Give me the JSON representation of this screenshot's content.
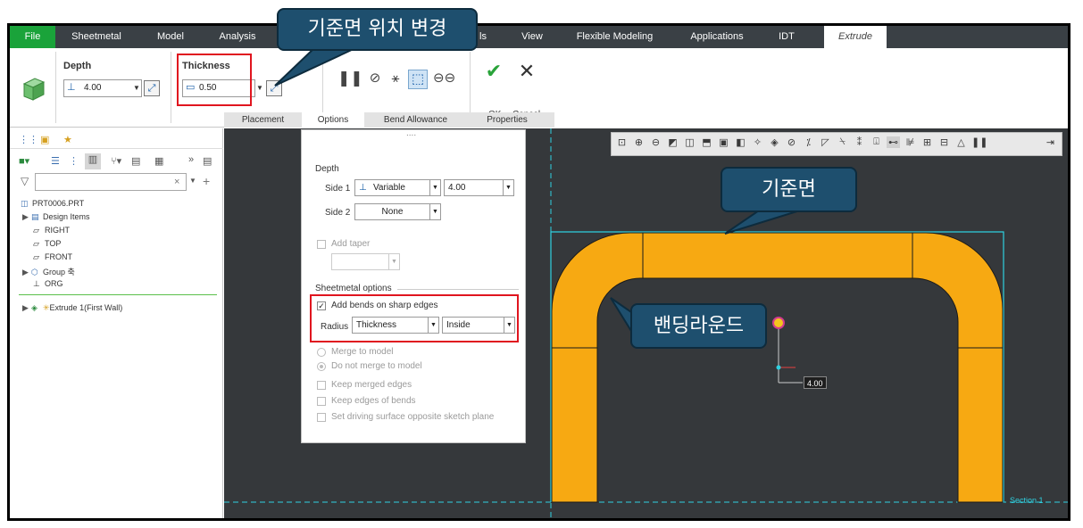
{
  "menu": {
    "file": "File",
    "tabs": [
      "Sheetmetal",
      "Model",
      "Analysis",
      "ls",
      "View",
      "Flexible Modeling",
      "Applications",
      "IDT",
      "Extrude"
    ]
  },
  "ribbon": {
    "depth_label": "Depth",
    "depth_value": "4.00",
    "thickness_label": "Thickness",
    "thickness_value": "0.50",
    "ok": "OK",
    "cancel": "Cancel",
    "subtabs": [
      "Placement",
      "Options",
      "Bend Allowance",
      "Properties"
    ]
  },
  "tree": {
    "root": "PRT0006.PRT",
    "items": [
      "Design Items",
      "RIGHT",
      "TOP",
      "FRONT",
      "Group 축",
      "ORG",
      "Extrude 1(First Wall)"
    ]
  },
  "options": {
    "dots": "....",
    "depth_header": "Depth",
    "side1_label": "Side 1",
    "side1_type": "Variable",
    "side1_value": "4.00",
    "side2_label": "Side 2",
    "side2_type": "None",
    "add_taper": "Add taper",
    "sheetmetal_header": "Sheetmetal options",
    "add_bends": "Add bends on sharp edges",
    "radius_label": "Radius",
    "radius_type": "Thickness",
    "radius_side": "Inside",
    "merge_to_model": "Merge to model",
    "do_not_merge": "Do not merge to model",
    "keep_merged": "Keep merged edges",
    "keep_edges_bends": "Keep edges of bends",
    "set_driving": "Set driving surface opposite sketch plane"
  },
  "graphics": {
    "dimension": "4.00",
    "section_label": "Section 1"
  },
  "callouts": {
    "top": "기준면 위치 변경",
    "mid": "기준면",
    "bend": "밴딩라운드"
  },
  "colors": {
    "part": "#f7a912",
    "accent_green": "#1aa33a",
    "callout": "#1e4f6e",
    "highlight": "#e0151f"
  }
}
